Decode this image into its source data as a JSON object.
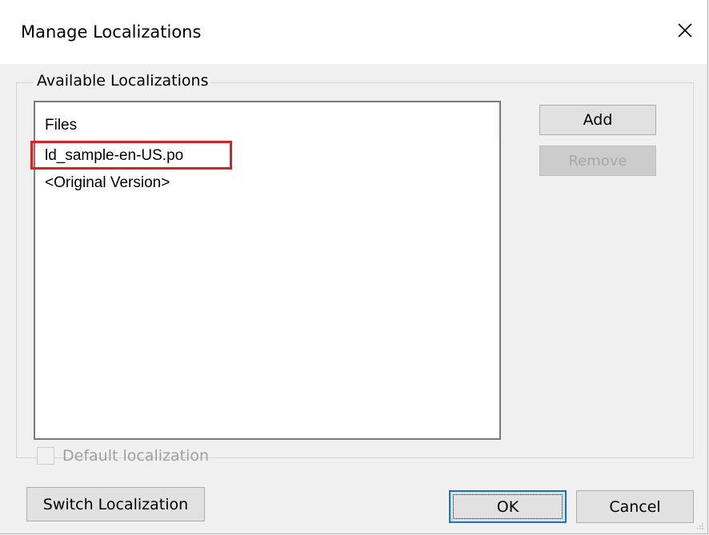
{
  "window": {
    "title": "Manage Localizations",
    "close_glyph": "✕"
  },
  "group": {
    "legend": "Available Localizations"
  },
  "list": {
    "column_header": "Files",
    "items": [
      "ld_sample-en-US.po",
      "<Original Version>"
    ],
    "highlight_color": "#e02020"
  },
  "buttons": {
    "add": "Add",
    "remove": "Remove",
    "switch": "Switch Localization",
    "ok": "OK",
    "cancel": "Cancel"
  },
  "checkbox": {
    "label": "Default localization",
    "checked": false,
    "enabled": false
  },
  "colors": {
    "dialog_bg": "#f0f0f0",
    "focus_border": "#0078d7"
  }
}
